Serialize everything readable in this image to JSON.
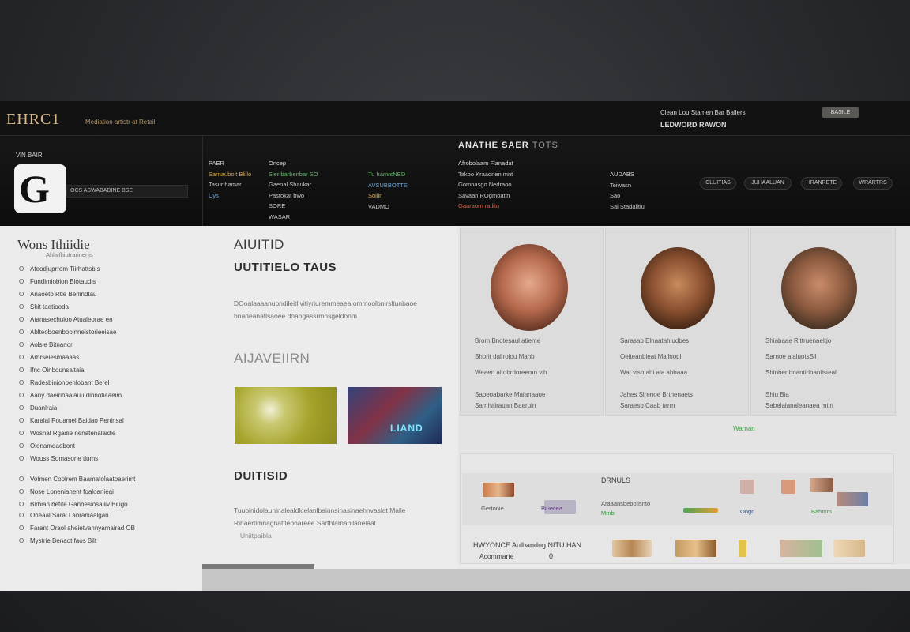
{
  "topbar": {
    "brand": "EHRC1",
    "tagline": "Mediation artistr at Retail",
    "right_line1": "Clean Lou Stamen Bar Ballers",
    "right_line2": "LEDWORD RAWON",
    "right_button": "BASILE"
  },
  "header": {
    "account_label": "ViN BAIR",
    "account_field": "OCS ASWABADINE BSE",
    "title": "ANATHE SAER",
    "title_suffix": "TOTS",
    "columns": [
      {
        "lines": [
          "PAER",
          "Sarnaubolt Blillo",
          "Tasur hamar",
          "Cys"
        ]
      },
      {
        "lines": [
          "Oncep",
          "Sier barbenbar SO",
          "Gaenal Shaukar",
          "Pastokat bwo",
          "SORE",
          "WASAR"
        ]
      },
      {
        "lines": [
          "Tu hamrsNED",
          "AVSUBBOTTS",
          "Sollin",
          "VADMO"
        ]
      },
      {
        "lines": [
          "Afrobolaam Flanadat",
          "Takbo Kraadnen mnt",
          "Gomnasgo Nedraoo",
          "Savaan ROgmoatin",
          "Gaaraorn ratlitn"
        ]
      },
      {
        "lines": [
          "AUDABS",
          "Teiwasn",
          "Sao",
          "Sai Stadalitiu"
        ]
      }
    ],
    "buttons": [
      "CLUITIAS",
      "JUHAALUAN",
      "HRANRETE",
      "WRARTRS"
    ]
  },
  "sidebar": {
    "title": "Wons Ithiidie",
    "subtitle": "Ahlaifhiutrarinenis",
    "items": [
      {
        "icon": "O",
        "label": "Ateodjuprrom Tiirhattsbis"
      },
      {
        "icon": "O",
        "label": "Fundimiobion Biotaudis"
      },
      {
        "icon": "O",
        "label": "Anaoeto Rtle Berlindtau"
      },
      {
        "icon": "O",
        "label": "Shit taetiooda"
      },
      {
        "icon": "O",
        "label": "Atanasechuioo Atualeorae en"
      },
      {
        "icon": "O",
        "label": "Ablteoboenboolnneistorieeisae"
      },
      {
        "icon": "O",
        "label": "Aolsie Bitnanor"
      },
      {
        "icon": "O",
        "label": "Arbrseiesmaaaas"
      },
      {
        "icon": "O",
        "label": "Ifnc Oinbounsaitaia"
      },
      {
        "icon": "O",
        "label": "Radesbinionoenlobant Berel"
      },
      {
        "icon": "O",
        "label": "Aany daeirihaaiauu dinnotiaaeim"
      },
      {
        "icon": "O",
        "label": "Duanlraia"
      },
      {
        "icon": "O",
        "label": "Karaial Pouamei Baidao Peninsal"
      },
      {
        "icon": "O",
        "label": "Wosnal Rgadie nenatenalaidie"
      },
      {
        "icon": "O",
        "label": "Oionamdaebont"
      },
      {
        "icon": "O",
        "label": "Wouss Somasorie tiums"
      },
      {
        "icon": "O",
        "label": "Votmen Coolrem Baamatolaatoaerimt"
      },
      {
        "icon": "O",
        "label": "Nose Lonenianent foaloanieai"
      },
      {
        "icon": "O",
        "label": "Birbian betite Ganbesiosaliiv Biugo"
      },
      {
        "icon": "O",
        "label": "Oneaal Saral Lanraniaalgan"
      },
      {
        "icon": "O",
        "label": "Farant Oraol aheietvannyamairad OB"
      },
      {
        "icon": "O",
        "label": "Mystrie Benaot faos Bilt"
      }
    ]
  },
  "main": {
    "about_title": "AIUITID",
    "about_subtitle": "UUTITIELO TAUS",
    "about_text": "DOoalaaaanubndileitl vitiyriuremmeaea ommoolbnirsltunbaoe bnarleanatlsaoee doaogassrmnsgeldonm",
    "section2_title": "AIJAVEIIRN",
    "thumb2_label": "LIAND",
    "section3_title": "DUITISID",
    "section3_text": "Tuuoinidolauninalealdlcelanlbainnsinasinaehnvaslat Malle Rinaertimnagnattleonareee Sarthlamahilanelaat",
    "section3_link": "Uniitpaibla"
  },
  "cards": [
    {
      "lines": [
        "Brom Bnotesaul atieme",
        "Shorit dallroiou Mahb",
        "Weaen altdbrdoreemn vih",
        "Sabeoabarke Maianaaoe",
        "Samhairauan Baeruin"
      ]
    },
    {
      "lines": [
        "Sarasab Elnaatahiudbes",
        "Oeiteanbieat Mailnodl",
        "Wat vish ahi aia ahbaaa",
        "Jahes Sirenoe Brtnenaets",
        "Saraesb Caab tarm"
      ]
    },
    {
      "lines": [
        "Shiabaae Rittruenaeltjo",
        "Sarnoe alaluotsSil",
        "Shinber bnantirlbanlisteal",
        "Shiu Bia",
        "Sabelaianaleanaea mtin"
      ]
    }
  ],
  "view_more": "Warnan",
  "lower_panel": {
    "row1_title": "DRNULS",
    "items": [
      "Gertonie",
      "Biuecea",
      "Araaansbeboiisnto",
      "Mmb",
      "Ongr",
      "Bahtom"
    ],
    "row2_title": "HWYONCE Aulbandng NITU HAN",
    "row2_sub": "Acommarte",
    "row2_num": "0"
  }
}
